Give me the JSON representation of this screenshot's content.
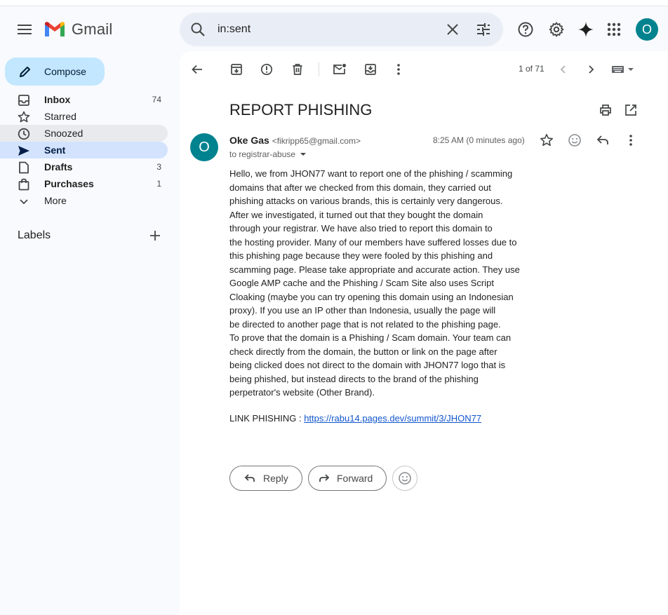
{
  "app": {
    "name": "Gmail",
    "account_initial": "O"
  },
  "colors": {
    "compose_bg": "#c2e7ff",
    "active_bg": "#d3e3fd",
    "avatar": "#00838f",
    "link": "#1155cc",
    "search_bg": "#e9eef6"
  },
  "search": {
    "query": "in:sent"
  },
  "sidebar": {
    "compose_label": "Compose",
    "items": [
      {
        "label": "Inbox",
        "count": "74",
        "icon": "inbox-icon"
      },
      {
        "label": "Starred",
        "count": "",
        "icon": "star-icon"
      },
      {
        "label": "Snoozed",
        "count": "",
        "icon": "clock-icon"
      },
      {
        "label": "Sent",
        "count": "",
        "icon": "send-icon"
      },
      {
        "label": "Drafts",
        "count": "3",
        "icon": "draft-icon"
      },
      {
        "label": "Purchases",
        "count": "1",
        "icon": "shopping-bag-icon"
      },
      {
        "label": "More",
        "count": "",
        "icon": "chevron-down-icon"
      }
    ],
    "labels_heading": "Labels"
  },
  "toolbar": {
    "pager": "1 of 71"
  },
  "message": {
    "subject": "REPORT PHISHING",
    "sender_initial": "O",
    "sender_name": "Oke Gas",
    "sender_email": "<fikripp65@gmail.com>",
    "to": "to registrar-abuse",
    "time": "8:25 AM (0 minutes ago)",
    "body_lines": [
      "Hello, we from JHON77 want to report one of the phishing / scamming",
      "domains that after we checked from this domain, they carried out",
      "phishing attacks on various brands, this is certainly very dangerous.",
      "After we investigated, it turned out that they bought the domain",
      "through your registrar. We have also tried to report this domain to",
      "the hosting provider. Many of our members have suffered losses due to",
      "this phishing page because they were fooled by this phishing and",
      "scamming page. Please take appropriate and accurate action. They use",
      "Google AMP cache and the Phishing / Scam Site also uses Script",
      "Cloaking (maybe you can try opening this domain using an Indonesian",
      "proxy). If you use an IP other than Indonesia, usually the page will",
      "be directed to another page that is not related to the phishing page.",
      "To prove that the domain is a Phishing / Scam domain. Your team can",
      "check directly from the domain, the button or link on the page after",
      "being clicked does not direct to the domain with JHON77 logo that is",
      "being phished, but instead directs to the brand of the phishing",
      "perpetrator's website (Other Brand)."
    ],
    "link_prefix": "LINK PHISHING : ",
    "link_url": "https://rabu14.pages.dev/summit/3/JHON77"
  },
  "actions": {
    "reply_label": "Reply",
    "forward_label": "Forward"
  }
}
